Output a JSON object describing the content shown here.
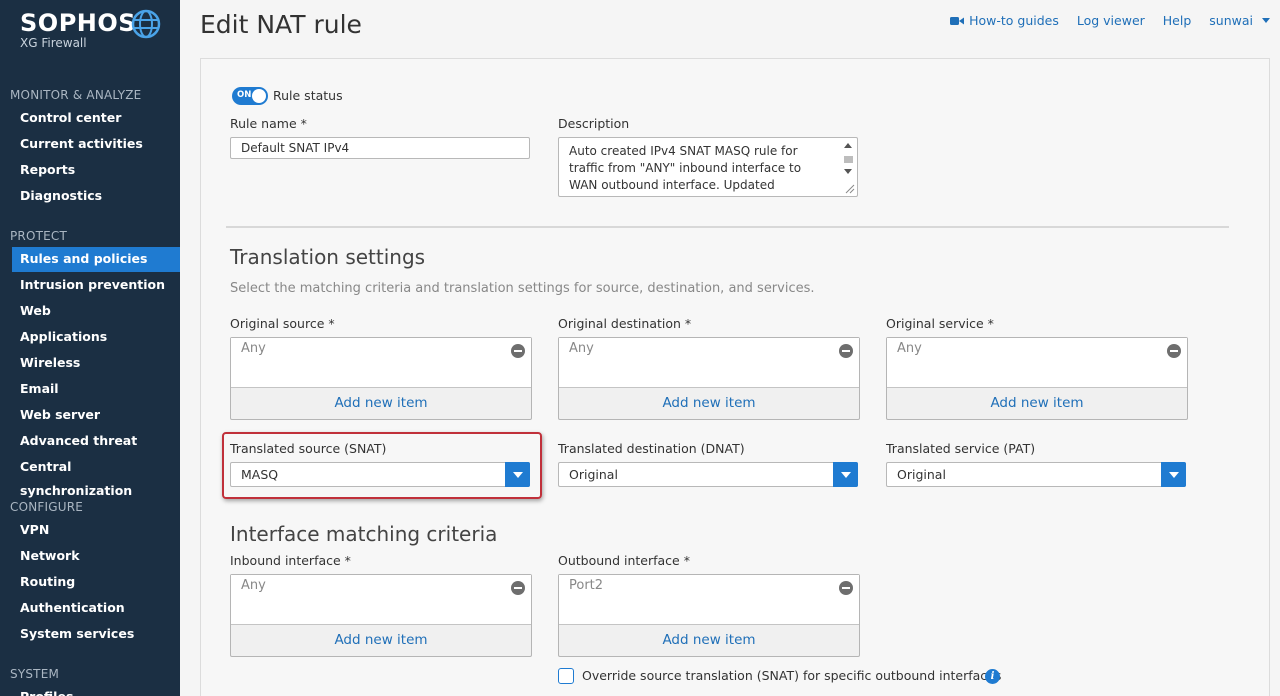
{
  "brand": {
    "name": "SOPHOS",
    "product": "XG Firewall"
  },
  "sidebar": {
    "sections": [
      {
        "title": "MONITOR & ANALYZE",
        "items": [
          "Control center",
          "Current activities",
          "Reports",
          "Diagnostics"
        ]
      },
      {
        "title": "PROTECT",
        "items": [
          "Rules and policies",
          "Intrusion prevention",
          "Web",
          "Applications",
          "Wireless",
          "Email",
          "Web server",
          "Advanced threat",
          "Central synchronization"
        ]
      },
      {
        "title": "CONFIGURE",
        "items": [
          "VPN",
          "Network",
          "Routing",
          "Authentication",
          "System services"
        ]
      },
      {
        "title": "SYSTEM",
        "items": [
          "Profiles"
        ]
      }
    ],
    "active": "Rules and policies"
  },
  "header": {
    "title": "Edit NAT rule",
    "links": {
      "howto": "How-to guides",
      "log": "Log viewer",
      "help": "Help",
      "user": "sunwai"
    }
  },
  "form": {
    "status": {
      "toggle": "ON",
      "label": "Rule status"
    },
    "rule_name": {
      "label": "Rule name *",
      "value": "Default SNAT IPv4"
    },
    "description": {
      "label": "Description",
      "value": "Auto created IPv4 SNAT MASQ rule for traffic from \"ANY\" inbound interface to WAN outbound interface. Updated automatically with WAN"
    },
    "translation": {
      "title": "Translation settings",
      "desc": "Select the matching criteria and translation settings for source, destination, and services.",
      "orig_source": {
        "label": "Original source *",
        "value": "Any",
        "add": "Add new item"
      },
      "orig_dest": {
        "label": "Original destination *",
        "value": "Any",
        "add": "Add new item"
      },
      "orig_service": {
        "label": "Original service *",
        "value": "Any",
        "add": "Add new item"
      },
      "trans_source": {
        "label": "Translated source (SNAT)",
        "value": "MASQ"
      },
      "trans_dest": {
        "label": "Translated destination (DNAT)",
        "value": "Original"
      },
      "trans_service": {
        "label": "Translated service (PAT)",
        "value": "Original"
      }
    },
    "interface": {
      "title": "Interface matching criteria",
      "inbound": {
        "label": "Inbound interface *",
        "value": "Any",
        "add": "Add new item"
      },
      "outbound": {
        "label": "Outbound interface *",
        "value": "Port2",
        "add": "Add new item"
      },
      "override_label": "Override source translation (SNAT) for specific outbound interfaces"
    }
  },
  "colors": {
    "sidebar": "#1b2f43",
    "accent": "#1f7bd1",
    "highlight": "#c0303a"
  }
}
